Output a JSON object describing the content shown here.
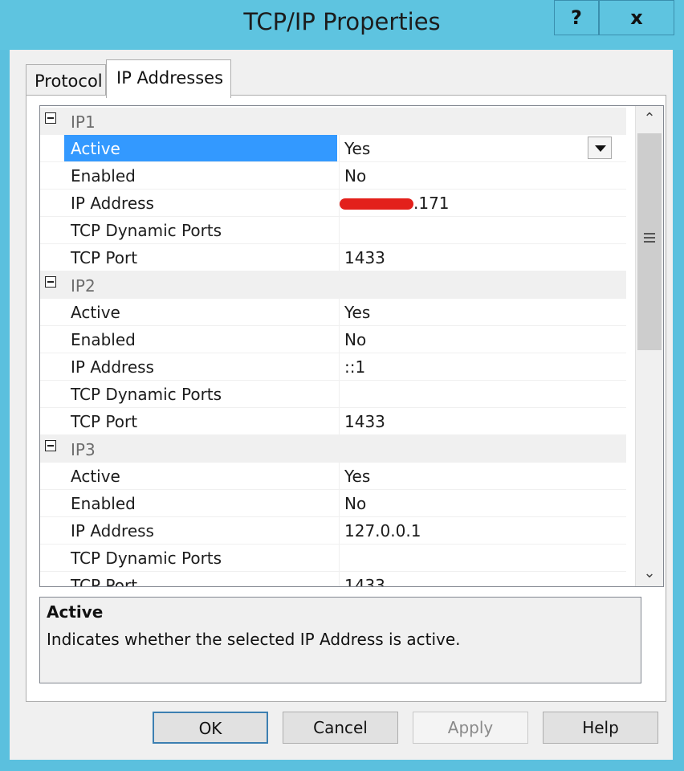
{
  "window": {
    "title": "TCP/IP Properties",
    "help_button": "?",
    "close_button": "x"
  },
  "tabs": [
    {
      "label": "Protocol"
    },
    {
      "label": "IP Addresses"
    }
  ],
  "grid": {
    "groups": [
      {
        "name": "IP1",
        "props": [
          {
            "name": "Active",
            "value": "Yes",
            "selected": true
          },
          {
            "name": "Enabled",
            "value": "No"
          },
          {
            "name": "IP Address",
            "value": ".171",
            "redacted": true
          },
          {
            "name": "TCP Dynamic Ports",
            "value": ""
          },
          {
            "name": "TCP Port",
            "value": "1433"
          }
        ]
      },
      {
        "name": "IP2",
        "props": [
          {
            "name": "Active",
            "value": "Yes"
          },
          {
            "name": "Enabled",
            "value": "No"
          },
          {
            "name": "IP Address",
            "value": "::1"
          },
          {
            "name": "TCP Dynamic Ports",
            "value": ""
          },
          {
            "name": "TCP Port",
            "value": "1433"
          }
        ]
      },
      {
        "name": "IP3",
        "props": [
          {
            "name": "Active",
            "value": "Yes"
          },
          {
            "name": "Enabled",
            "value": "No"
          },
          {
            "name": "IP Address",
            "value": "127.0.0.1"
          },
          {
            "name": "TCP Dynamic Ports",
            "value": ""
          },
          {
            "name": "TCP Port",
            "value": "1433"
          }
        ]
      }
    ],
    "scroll_up_icon": "chevron-up-icon",
    "scroll_down_icon": "chevron-down-icon",
    "dropdown_icon": "triangle-down-icon"
  },
  "description": {
    "title": "Active",
    "text": "Indicates whether the selected IP Address is active."
  },
  "buttons": {
    "ok": "OK",
    "cancel": "Cancel",
    "apply": "Apply",
    "help": "Help"
  },
  "colors": {
    "titlebar": "#5ec4e0",
    "selection": "#3399ff",
    "redaction": "#e3201b"
  }
}
